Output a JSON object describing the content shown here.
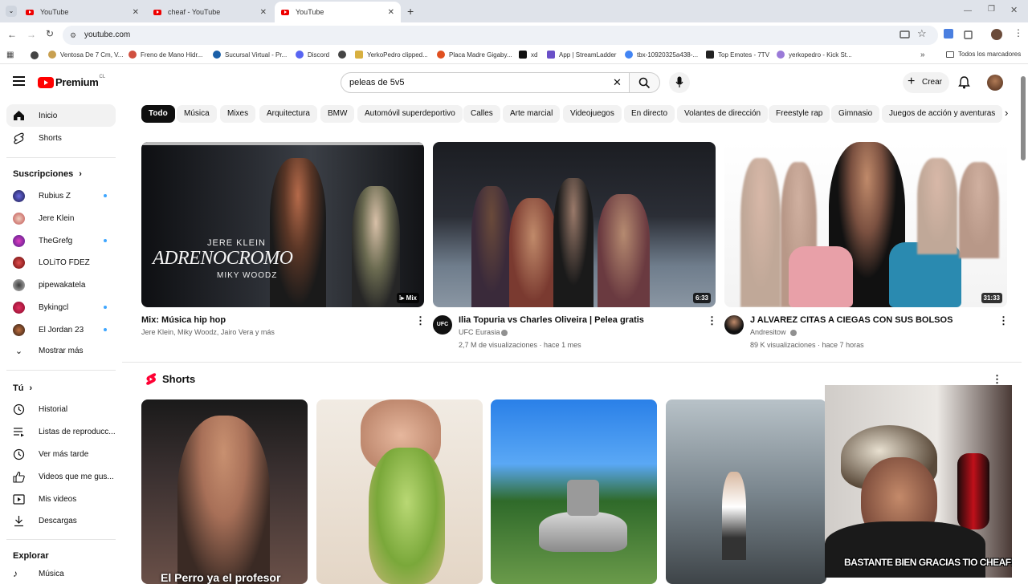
{
  "browser": {
    "tabs": [
      {
        "title": "YouTube"
      },
      {
        "title": "cheaf - YouTube"
      },
      {
        "title": "YouTube"
      }
    ],
    "url": "youtube.com",
    "bookmarks": [
      "Ventosa De 7 Cm, V...",
      "Freno de Mano Hidr...",
      "Sucursal Virtual - Pr...",
      "Discord",
      "YerkoPedro clipped...",
      "Placa Madre Gigaby...",
      "xd",
      "App | StreamLadder",
      "tbx-10920325a438-...",
      "Top Emotes - 7TV",
      "yerkopedro - Kick St..."
    ],
    "all_bookmarks": "Todos los marcadores"
  },
  "youtube": {
    "logo_text": "Premium",
    "region": "CL",
    "search_value": "peleas de 5v5",
    "create_label": "Crear",
    "chips": [
      "Todo",
      "Música",
      "Mixes",
      "Arquitectura",
      "BMW",
      "Automóvil superdeportivo",
      "Calles",
      "Arte marcial",
      "Videojuegos",
      "En directo",
      "Volantes de dirección",
      "Freestyle rap",
      "Gimnasio",
      "Juegos de acción y aventuras"
    ],
    "nav": {
      "home": "Inicio",
      "shorts": "Shorts"
    },
    "subscriptions_title": "Suscripciones",
    "subscriptions": [
      "Rubius Z",
      "Jere Klein",
      "TheGrefg",
      "LOLiTO FDEZ",
      "pipewakatela",
      "Bykingcl",
      "El Jordan 23"
    ],
    "show_more": "Mostrar más",
    "you_title": "Tú",
    "you_items": [
      "Historial",
      "Listas de reproducc...",
      "Ver más tarde",
      "Videos que me gus...",
      "Mis videos",
      "Descargas"
    ],
    "explore_title": "Explorar",
    "explore_items": [
      "Música"
    ],
    "videos": [
      {
        "title": "Mix: Música hip hop",
        "channel": "Jere Klein, Miky Woodz, Jairo Vera y más",
        "badge": "Mix",
        "thumb_text_1": "JERE KLEIN",
        "thumb_text_2": "ADRENOCROMO",
        "thumb_text_3": "MIKY WOODZ"
      },
      {
        "title": "Ilia Topuria vs Charles Oliveira | Pelea gratis",
        "channel": "UFC Eurasia",
        "stats": "2,7 M de visualizaciones · hace 1 mes",
        "duration": "6:33",
        "channel_logo": "UFC"
      },
      {
        "title": "J ALVAREZ CITAS A CIEGAS CON SUS BOLSOS",
        "channel": "Andresitow",
        "stats": "89 K visualizaciones · hace 7 horas",
        "duration": "31:33"
      }
    ],
    "shorts_title": "Shorts",
    "shorts_caption_1": "El Perro ya el profesor",
    "webcam_caption": "BASTANTE BIEN GRACIAS TIO CHEAF!"
  }
}
